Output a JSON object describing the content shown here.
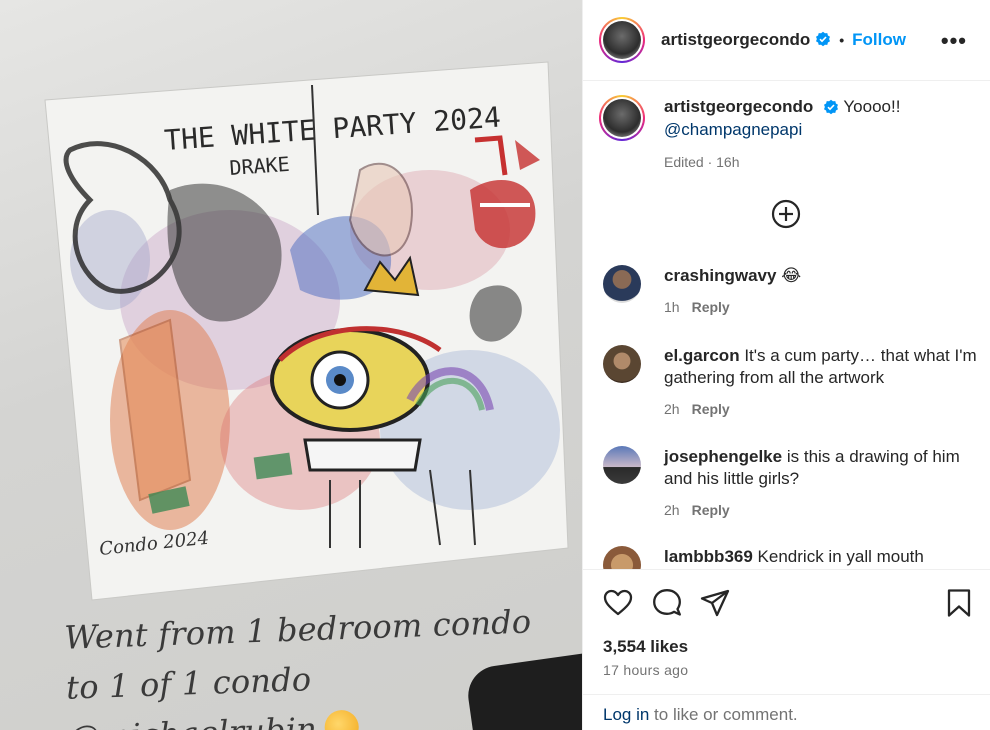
{
  "media": {
    "artwork_title": "THE WHITE PARTY 2024",
    "artwork_subtitle": "DRAKE",
    "signature": "Condo 2024",
    "overlay_text_prefix": "Went from 1 bedroom condo to 1 of 1 condo ",
    "overlay_mention": "@michaelrubin",
    "overlay_emoji_icon": "exploding-head-emoji"
  },
  "post": {
    "author": "artistgeorgecondo",
    "dot": "•",
    "follow_label": "Follow",
    "more_icon": "more-horizontal-icon",
    "caption_text": "Yoooo!!",
    "caption_mention": "@champagnepapi",
    "caption_meta": "Edited · 16h",
    "colors": {
      "link": "#0095f6",
      "mention": "#00376b",
      "muted": "#737373"
    }
  },
  "comments": [
    {
      "username": "crashingwavy",
      "text": "😂",
      "time": "1h",
      "reply": "Reply"
    },
    {
      "username": "el.garcon",
      "text": "It's a cum party… that what I'm gathering from all the artwork",
      "time": "2h",
      "reply": "Reply"
    },
    {
      "username": "josephengelke",
      "text": "is this a drawing of him and his little girls?",
      "time": "2h",
      "reply": "Reply"
    },
    {
      "username": "lambbb369",
      "text": "Kendrick in yall mouth",
      "time": "",
      "reply": ""
    }
  ],
  "actions": {
    "likes": "3,554 likes",
    "time_ago": "17 hours ago"
  },
  "login": {
    "link": "Log in",
    "text": " to like or comment."
  }
}
